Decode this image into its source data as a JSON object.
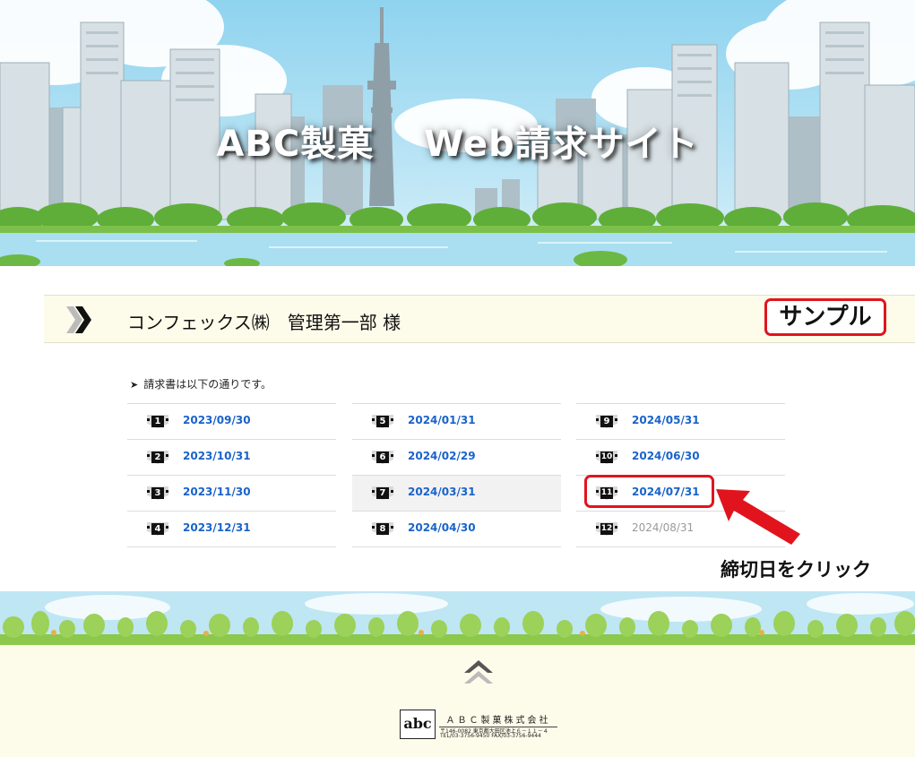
{
  "header": {
    "title": "ABC製菓　 Web請求サイト"
  },
  "customer": {
    "name": "コンフェックス㈱　管理第一部 様",
    "sample_label": "サンプル"
  },
  "intro": {
    "bullet": "➤",
    "text": "請求書は以下の通りです。"
  },
  "invoices": {
    "columns": [
      [
        {
          "number": "1",
          "date": "2023/09/30",
          "active": true
        },
        {
          "number": "2",
          "date": "2023/10/31",
          "active": true
        },
        {
          "number": "3",
          "date": "2023/11/30",
          "active": true
        },
        {
          "number": "4",
          "date": "2023/12/31",
          "active": true
        }
      ],
      [
        {
          "number": "5",
          "date": "2024/01/31",
          "active": true
        },
        {
          "number": "6",
          "date": "2024/02/29",
          "active": true
        },
        {
          "number": "7",
          "date": "2024/03/31",
          "active": true
        },
        {
          "number": "8",
          "date": "2024/04/30",
          "active": true
        }
      ],
      [
        {
          "number": "9",
          "date": "2024/05/31",
          "active": true
        },
        {
          "number": "10",
          "date": "2024/06/30",
          "active": true
        },
        {
          "number": "11",
          "date": "2024/07/31",
          "active": true
        },
        {
          "number": "12",
          "date": "2024/08/31",
          "active": false
        }
      ]
    ]
  },
  "annotation": {
    "text": "締切日をクリック",
    "color": "#e1141e"
  },
  "footer": {
    "logo_text": "abc",
    "company_name": "ＡＢＣ製菓株式会社",
    "address": "〒146-0082 東京都大田区池上６－１１－４",
    "contact": "TEL/03-3756-9450 FAX/03-3756-9444"
  },
  "colors": {
    "link": "#1a63c9",
    "inactive_link": "#9a9a9a",
    "accent_red": "#e1141e",
    "bar_background": "#fdfcea"
  },
  "icons": [
    "double-chevron-right-icon",
    "number-badge-icon",
    "back-to-top-icon",
    "red-arrow-icon"
  ]
}
